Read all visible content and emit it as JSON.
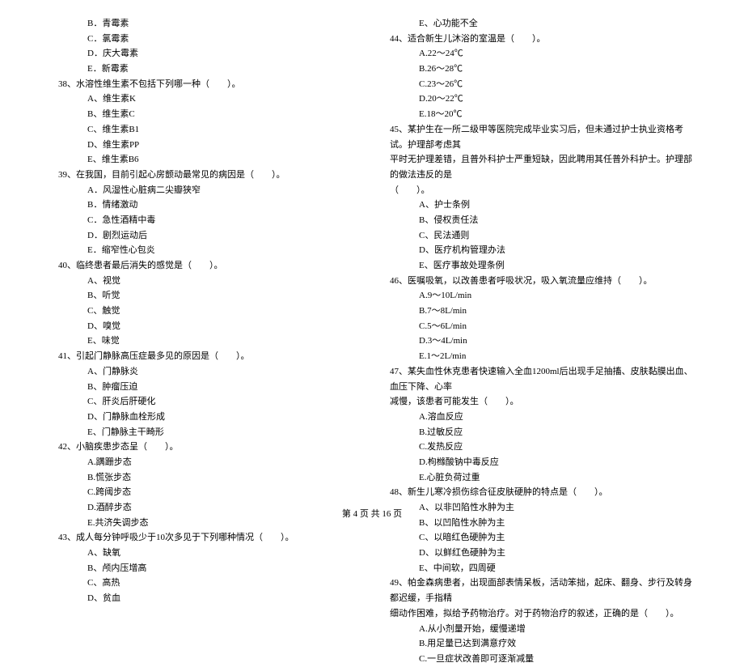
{
  "left": {
    "opts37": [
      "B．青霉素",
      "C．氯霉素",
      "D．庆大霉素",
      "E．新霉素"
    ],
    "q38": "38、水溶性维生素不包括下列哪一种（　　）。",
    "opts38": [
      "A、维生素K",
      "B、维生素C",
      "C、维生素B1",
      "D、维生素PP",
      "E、维生素B6"
    ],
    "q39": "39、在我国，目前引起心房颤动最常见的病因是（　　）。",
    "opts39": [
      "A．风湿性心脏病二尖瓣狭窄",
      "B．情绪激动",
      "C．急性酒精中毒",
      "D．剧烈运动后",
      "E．缩窄性心包炎"
    ],
    "q40": "40、临终患者最后消失的感觉是（　　）。",
    "opts40": [
      "A、视觉",
      "B、听觉",
      "C、触觉",
      "D、嗅觉",
      "E、味觉"
    ],
    "q41": "41、引起门静脉高压症最多见的原因是（　　）。",
    "opts41": [
      "A、门静脉炎",
      "B、肿瘤压迫",
      "C、肝炎后肝硬化",
      "D、门静脉血栓形成",
      "E、门静脉主干畸形"
    ],
    "q42": "42、小脑疾患步态呈（　　）。",
    "opts42": [
      "A.蹒跚步态",
      "B.慌张步态",
      "C.跨阈步态",
      "D.酒醉步态",
      "E.共济失调步态"
    ],
    "q43": "43、成人每分钟呼吸少于10次多见于下列哪种情况（　　）。",
    "opts43": [
      "A、缺氧",
      "B、颅内压增高",
      "C、高热",
      "D、贫血"
    ]
  },
  "right": {
    "opts43e": [
      "E、心功能不全"
    ],
    "q44": "44、适合新生儿沐浴的室温是（　　）。",
    "opts44": [
      "A.22～24℃",
      "B.26～28℃",
      "C.23～26℃",
      "D.20～22℃",
      "E.18～20℃"
    ],
    "q45a": "45、某护生在一所二级甲等医院完成毕业实习后，但未通过护士执业资格考试。护理部考虑其",
    "q45b": "平时无护理差错，且普外科护士严重短缺，因此聘用其任普外科护士。护理部的做法违反的是",
    "q45c": "（　　）。",
    "opts45": [
      "A、护士条例",
      "B、侵权责任法",
      "C、民法通则",
      "D、医疗机构管理办法",
      "E、医疗事故处理条例"
    ],
    "q46": "46、医嘱吸氧，以改善患者呼吸状况，吸入氧流量应维持（　　）。",
    "opts46": [
      "A.9～10L/min",
      "B.7～8L/min",
      "C.5～6L/min",
      "D.3～4L/min",
      "E.1～2L/min"
    ],
    "q47a": "47、某失血性休克患者快速输入全血1200ml后出现手足抽搐、皮肤黏膜出血、血压下降、心率",
    "q47b": "减慢，该患者可能发生（　　）。",
    "opts47": [
      "A.溶血反应",
      "B.过敏反应",
      "C.发热反应",
      "D.枸橼酸钠中毒反应",
      "E.心脏负荷过重"
    ],
    "q48": "48、新生儿寒冷损伤综合征皮肤硬肿的特点是（　　）。",
    "opts48": [
      "A、以非凹陷性水肿为主",
      "B、以凹陷性水肿为主",
      "C、以暗红色硬肿为主",
      "D、以鲜红色硬肿为主",
      "E、中间软，四周硬"
    ],
    "q49a": "49、帕金森病患者，出现面部表情呆板，活动笨拙，起床、翻身、步行及转身都迟缓，手指精",
    "q49b": "细动作困难，拟给予药物治疗。对于药物治疗的叙述，正确的是（　　）。",
    "opts49": [
      "A.从小剂量开始，缓慢递增",
      "B.用足量已达到满意疗效",
      "C.一旦症状改善即可逐渐减量"
    ]
  },
  "footer": "第 4 页 共 16 页"
}
